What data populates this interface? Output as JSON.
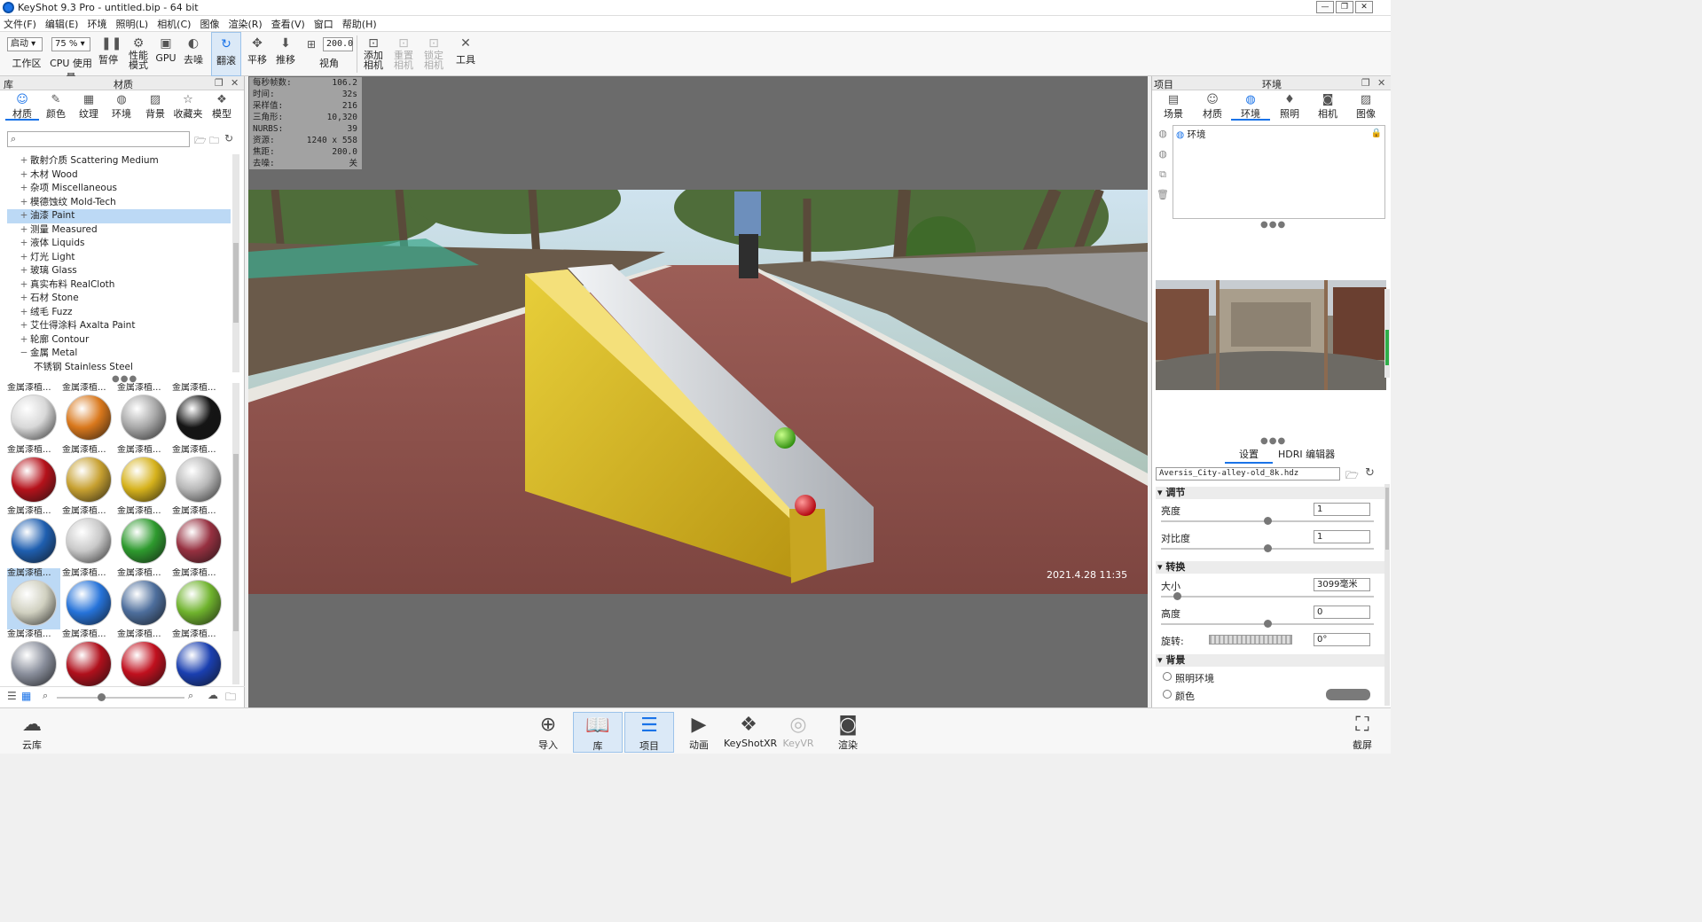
{
  "window": {
    "title": "KeyShot 9.3 Pro  - untitled.bip  - 64 bit",
    "minimize": "—",
    "restore": "❐",
    "close": "✕"
  },
  "menu": [
    "文件(F)",
    "编辑(E)",
    "环境",
    "照明(L)",
    "相机(C)",
    "图像",
    "渲染(R)",
    "查看(V)",
    "窗口",
    "帮助(H)"
  ],
  "toolbar": {
    "workspace_select": "启动",
    "workspace_label": "工作区",
    "cpu_select": "75 %",
    "cpu_label": "CPU 使用量",
    "pause_label": "暂停",
    "performance_label": "性能\n模式",
    "gpu_label": "GPU",
    "denoise_label": "去噪",
    "tumble_label": "翻滚",
    "pan_label": "平移",
    "dolly_label": "推移",
    "fov_value": "200.0",
    "fov_label": "视角",
    "add_camera_label": "添加\n相机",
    "reset_camera_label": "重置\n相机",
    "lock_camera_label": "锁定\n相机",
    "tools_label": "工具"
  },
  "library": {
    "header_left": "库",
    "header_center": "材质",
    "tabs": [
      {
        "label": "材质",
        "icon": "person-icon"
      },
      {
        "label": "颜色",
        "icon": "palette-icon"
      },
      {
        "label": "纹理",
        "icon": "texture-icon"
      },
      {
        "label": "环境",
        "icon": "globe-icon"
      },
      {
        "label": "背景",
        "icon": "image-icon"
      },
      {
        "label": "收藏夹",
        "icon": "star-icon"
      },
      {
        "label": "模型",
        "icon": "cube-icon"
      }
    ],
    "search_placeholder": "",
    "tree": [
      {
        "label": "散射介质 Scattering Medium",
        "expander": "+"
      },
      {
        "label": "木材 Wood",
        "expander": "+"
      },
      {
        "label": "杂项 Miscellaneous",
        "expander": "+"
      },
      {
        "label": "模德蚀纹 Mold-Tech",
        "expander": "+"
      },
      {
        "label": "油漆 Paint",
        "expander": "+",
        "selected": true
      },
      {
        "label": "测量 Measured",
        "expander": "+"
      },
      {
        "label": "液体 Liquids",
        "expander": "+"
      },
      {
        "label": "灯光 Light",
        "expander": "+"
      },
      {
        "label": "玻璃 Glass",
        "expander": "+"
      },
      {
        "label": "真实布料 RealCloth",
        "expander": "+"
      },
      {
        "label": "石材 Stone",
        "expander": "+"
      },
      {
        "label": "绒毛 Fuzz",
        "expander": "+"
      },
      {
        "label": "艾仕得涂料 Axalta Paint",
        "expander": "+"
      },
      {
        "label": "轮廓 Contour",
        "expander": "+"
      },
      {
        "label": "金属 Metal",
        "expander": "−"
      },
      {
        "label": "不锈钢 Stainless Steel",
        "expander": "",
        "child": true
      }
    ],
    "thumb_label": "金属漆植...",
    "thumbs": [
      {
        "color": "#d8d8d8"
      },
      {
        "color": "#d9781c"
      },
      {
        "color": "#a8a8a8"
      },
      {
        "color": "#151515"
      },
      {
        "color": "#b5121b"
      },
      {
        "color": "#c7a030"
      },
      {
        "color": "#d6b21c"
      },
      {
        "color": "#b8b8b8"
      },
      {
        "color": "#1f5fb0"
      },
      {
        "color": "#c9c9c9"
      },
      {
        "color": "#2e9a2e"
      },
      {
        "color": "#963040"
      },
      {
        "color": "#d0d0c0",
        "selected": true
      },
      {
        "color": "#2673d9"
      },
      {
        "color": "#4d6e9c"
      },
      {
        "color": "#6fb32d"
      },
      {
        "color": "#8a8f9c"
      },
      {
        "color": "#b0101c"
      },
      {
        "color": "#c0101e"
      },
      {
        "color": "#1a3fb0"
      }
    ]
  },
  "stats": [
    {
      "label": "每秒帧数:",
      "value": "106.2"
    },
    {
      "label": "时间:",
      "value": "32s"
    },
    {
      "label": "采样值:",
      "value": "216"
    },
    {
      "label": "三角形:",
      "value": "10,320"
    },
    {
      "label": "NURBS:",
      "value": "39"
    },
    {
      "label": "资源:",
      "value": "1240 x 558"
    },
    {
      "label": "焦距:",
      "value": "200.0"
    },
    {
      "label": "去噪:",
      "value": "关"
    }
  ],
  "scene": {
    "timestamp": "2021.4.28 11:35"
  },
  "project": {
    "header_left": "项目",
    "header_center": "环境",
    "tabs": [
      {
        "label": "场景",
        "icon": "scene-icon"
      },
      {
        "label": "材质",
        "icon": "person-icon"
      },
      {
        "label": "环境",
        "icon": "globe-icon"
      },
      {
        "label": "照明",
        "icon": "bulb-icon"
      },
      {
        "label": "相机",
        "icon": "camera-icon"
      },
      {
        "label": "图像",
        "icon": "image-icon"
      }
    ],
    "env_item": "环境",
    "settings_tab": "设置",
    "hdri_editor_tab": "HDRI 编辑器",
    "hdr_file": "Aversis_City-alley-old_8k.hdz",
    "adjust": {
      "title": "调节",
      "brightness_label": "亮度",
      "brightness_value": "1",
      "brightness_pos": 0.5,
      "contrast_label": "对比度",
      "contrast_value": "1",
      "contrast_pos": 0.5
    },
    "transform": {
      "title": "转换",
      "size_label": "大小",
      "size_value": "3099毫米",
      "size_pos": 0.06,
      "height_label": "高度",
      "height_value": "0",
      "height_pos": 0.5,
      "rotation_label": "旋转:",
      "rotation_value": "0°"
    },
    "background": {
      "title": "背景",
      "option_lighting": "照明环境",
      "option_color": "颜色",
      "bg_color": "#7a7a7a"
    }
  },
  "bottombar": {
    "cloud": "云库",
    "import": "导入",
    "library": "库",
    "project": "项目",
    "animation": "动画",
    "keyshotxr": "KeyShotXR",
    "keyvr": "KeyVR",
    "render": "渲染",
    "screenshot": "截屏"
  }
}
